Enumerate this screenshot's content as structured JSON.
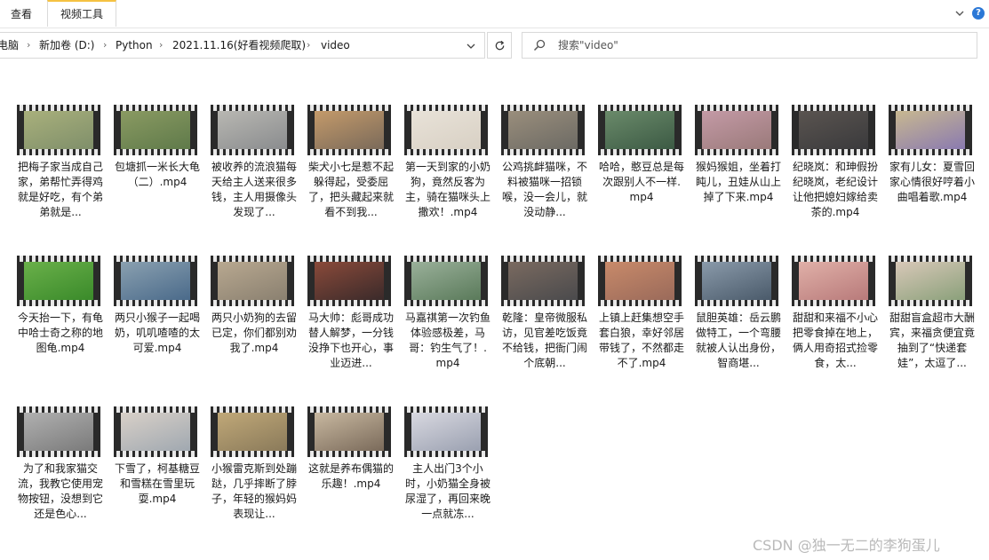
{
  "ribbon": {
    "tabs": [
      {
        "label": "查看"
      },
      {
        "label": "视频工具"
      }
    ]
  },
  "address": {
    "crumbs": [
      "电脑",
      "新加卷 (D:)",
      "Python",
      "2021.11.16(好看视频爬取)",
      "video"
    ]
  },
  "search": {
    "placeholder": "搜索\"video\""
  },
  "files": [
    {
      "name": "把梅子家当成自己家，弟帮忙弄得鸡就是好吃，有个弟弟就是...",
      "c1": "#7f8f6a",
      "c2": "#a9b07c"
    },
    {
      "name": "包塘抓一米长大龟（二）.mp4",
      "c1": "#5f7a4a",
      "c2": "#8a9a62"
    },
    {
      "name": "被收养的流浪猫每天给主人送来很多钱，主人用摄像头发现了...",
      "c1": "#8a8c8e",
      "c2": "#b8b7b2"
    },
    {
      "name": "柴犬小七是惹不起躲得起，受委屈了，把头藏起来就看不到我...",
      "c1": "#7a6a5a",
      "c2": "#c49a6a"
    },
    {
      "name": "第一天到家的小奶狗，竟然反客为主，骑在猫咪头上撒欢！.mp4",
      "c1": "#d8d0c4",
      "c2": "#e8e2d8"
    },
    {
      "name": "公鸡挑衅猫咪，不料被猫咪一招锁喉，没一会儿，就没动静...",
      "c1": "#6c6a64",
      "c2": "#9a8e7c"
    },
    {
      "name": "哈哈，憨豆总是每次跟别人不一样.mp4",
      "c1": "#3c5a44",
      "c2": "#6a8a6a"
    },
    {
      "name": "猴妈猴姐，坐着打盹儿，丑娃从山上掉了下来.mp4",
      "c1": "#9a7a7a",
      "c2": "#c49aa6"
    },
    {
      "name": "纪晓岚：和珅假扮纪晓岚，老纪设计让他把媳妇嫁给卖茶的.mp4",
      "c1": "#3a3a3c",
      "c2": "#5a5450"
    },
    {
      "name": "家有儿女：夏雪回家心情很好哼着小曲唱着歌.mp4",
      "c1": "#8a7ab0",
      "c2": "#c8b890"
    },
    {
      "name": "今天抬一下，有龟中哈士奇之称的地图龟.mp4",
      "c1": "#3a8a2a",
      "c2": "#6ab04a"
    },
    {
      "name": "两只小猴子一起喝奶，叽叽喳喳的太可爱.mp4",
      "c1": "#4a6a8a",
      "c2": "#8aa0b0"
    },
    {
      "name": "两只小奶狗的去留已定，你们都别劝我了.mp4",
      "c1": "#8a8070",
      "c2": "#b8a890"
    },
    {
      "name": "马大帅：彪哥成功替人解梦，一分钱没挣下也开心，事业迈进...",
      "c1": "#3a2a2a",
      "c2": "#8a4a3a"
    },
    {
      "name": "马嘉祺第一次钓鱼体验感极差，马哥：钓生气了！.mp4",
      "c1": "#5a7a5a",
      "c2": "#9ab09a"
    },
    {
      "name": "乾隆：皇帝微服私访，见官差吃饭竟不给钱，把衙门闹个底朝...",
      "c1": "#4a4a4c",
      "c2": "#7a6a60"
    },
    {
      "name": "上镇上赶集想空手套白狼，幸好邻居带钱了，不然都走不了.mp4",
      "c1": "#9a6a5a",
      "c2": "#c88a6a"
    },
    {
      "name": "鼠胆英雄：岳云鹏做特工，一个弯腰就被人认出身份，智商堪...",
      "c1": "#4a5a6a",
      "c2": "#8a9aaa"
    },
    {
      "name": "甜甜和来福不小心把零食掉在地上，俩人用奇招式捡零食，太...",
      "c1": "#b87a7a",
      "c2": "#e0b0a8"
    },
    {
      "name": "甜甜盲盒超市大酬宾，来福贪便宜竟抽到了“快递套娃”，太逗了...",
      "c1": "#8aa07a",
      "c2": "#d8c8b8"
    },
    {
      "name": "为了和我家猫交流，我教它使用宠物按钮，没想到它还是色心...",
      "c1": "#7a7a7a",
      "c2": "#b0b0b0"
    },
    {
      "name": "下雪了，柯基糖豆和雪糕在雪里玩耍.mp4",
      "c1": "#a0a8b0",
      "c2": "#d8d0c8"
    },
    {
      "name": "小猴雷克斯到处蹦跶，几乎摔断了脖子，年轻的猴妈妈表现让...",
      "c1": "#8a7a5a",
      "c2": "#c0a878"
    },
    {
      "name": "这就是养布偶猫的乐趣！.mp4",
      "c1": "#7a6a5a",
      "c2": "#c8b8a0"
    },
    {
      "name": "主人出门3个小时，小奶猫全身被尿湿了，再回来晚一点就冻...",
      "c1": "#9aa0b0",
      "c2": "#d8d8e0"
    }
  ],
  "watermark": "CSDN @独一无二的李狗蛋儿"
}
